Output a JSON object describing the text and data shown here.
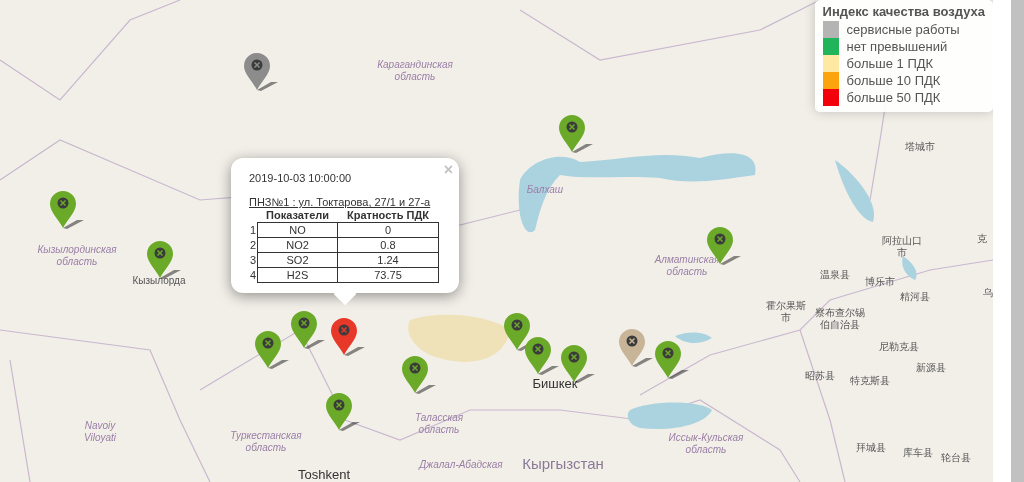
{
  "legend": {
    "title": "Индекс качества воздуха",
    "items": [
      {
        "label": "сервисные работы",
        "color": "#b4b4b4"
      },
      {
        "label": "нет превышений",
        "color": "#22b45a"
      },
      {
        "label": "больше 1 ПДК",
        "color": "#fde9a4"
      },
      {
        "label": "больше 10 ПДК",
        "color": "#fba40c"
      },
      {
        "label": "больше 50 ПДК",
        "color": "#f2000c"
      }
    ]
  },
  "popup": {
    "close": "×",
    "timestamp": "2019-10-03 10:00:00",
    "station": "ПНЗ№1 : ул. Токтарова, 27/1 и 27-а",
    "columns": [
      "Показатели",
      "Кратность ПДК"
    ],
    "rows": [
      {
        "index": "1",
        "indicator": "NO",
        "value": "0"
      },
      {
        "index": "2",
        "indicator": "NO2",
        "value": "0.8"
      },
      {
        "index": "3",
        "indicator": "SO2",
        "value": "1.24"
      },
      {
        "index": "4",
        "indicator": "H2S",
        "value": "73.75"
      }
    ]
  },
  "markers": [
    {
      "color": "#8c8c8c"
    },
    {
      "color": "#6aaa28"
    },
    {
      "color": "#6aaa28"
    },
    {
      "color": "#6aaa28"
    },
    {
      "color": "#6aaa28"
    },
    {
      "color": "#6aaa28"
    },
    {
      "color": "#6aaa28"
    },
    {
      "color": "#e8382a"
    },
    {
      "color": "#6aaa28"
    },
    {
      "color": "#6aaa28"
    },
    {
      "color": "#6aaa28"
    },
    {
      "color": "#6aaa28"
    },
    {
      "color": "#6aaa28"
    },
    {
      "color": "#c8b496"
    },
    {
      "color": "#6aaa28"
    }
  ],
  "map_labels": [
    {
      "text": "Карагандинская область",
      "kind": "region"
    },
    {
      "text": "Кызылординская область",
      "kind": "region"
    },
    {
      "text": "Кызылорда",
      "kind": "city"
    },
    {
      "text": "Балхаш",
      "kind": "region"
    },
    {
      "text": "Алматинская область",
      "kind": "region"
    },
    {
      "text": "塔城市",
      "kind": "city"
    },
    {
      "text": "阿拉山口市",
      "kind": "city"
    },
    {
      "text": "克",
      "kind": "city"
    },
    {
      "text": "温泉县",
      "kind": "city"
    },
    {
      "text": "博乐市",
      "kind": "city"
    },
    {
      "text": "精河县",
      "kind": "city"
    },
    {
      "text": "乌",
      "kind": "city"
    },
    {
      "text": "霍尔果斯市",
      "kind": "city"
    },
    {
      "text": "察布查尔锡伯自治县",
      "kind": "city"
    },
    {
      "text": "尼勒克县",
      "kind": "city"
    },
    {
      "text": "新源县",
      "kind": "city"
    },
    {
      "text": "昭苏县",
      "kind": "city"
    },
    {
      "text": "特克斯县",
      "kind": "city"
    },
    {
      "text": "Бишкек",
      "kind": "capital"
    },
    {
      "text": "Иссык-Кульская область",
      "kind": "region"
    },
    {
      "text": "Кыргызстан",
      "kind": "country"
    },
    {
      "text": "拜城县",
      "kind": "city"
    },
    {
      "text": "库车县",
      "kind": "city"
    },
    {
      "text": "轮台县",
      "kind": "city"
    },
    {
      "text": "Navoiy Viloyati",
      "kind": "region"
    },
    {
      "text": "Туркестанская область",
      "kind": "region"
    },
    {
      "text": "Таласская область",
      "kind": "region"
    },
    {
      "text": "Джалал-Абадская",
      "kind": "region"
    },
    {
      "text": "Toshkent",
      "kind": "capital"
    }
  ]
}
